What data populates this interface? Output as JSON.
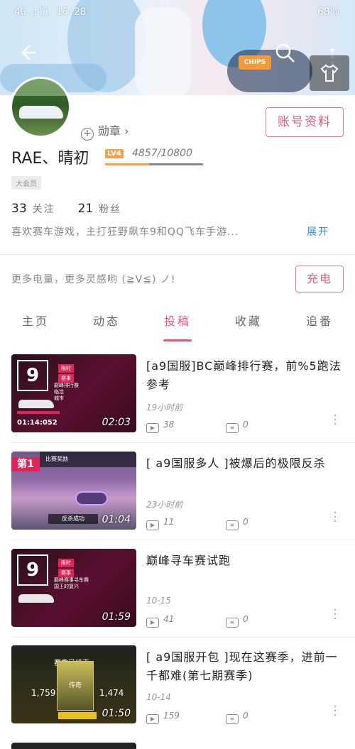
{
  "status_bar": {
    "left": "4G ıll 16:28",
    "right": "68%"
  },
  "header": {
    "banner_text": "CHIPS"
  },
  "profile": {
    "medal_label": "勋章",
    "account_button": "账号资料",
    "username": "RAE、晴初",
    "level": "LV4",
    "exp": "4857/10800",
    "exp_fraction": 0.45,
    "tag": "大会员",
    "following_count": "33",
    "following_label": "关注",
    "fans_count": "21",
    "fans_label": "粉丝",
    "bio": "喜欢赛车游戏，主打狂野飙车9和QQ飞车手游...",
    "expand": "展开"
  },
  "charge": {
    "text": "更多电量，更多灵感哟 (≧V≦) ノ!",
    "button": "充电"
  },
  "tabs": [
    {
      "label": "主页"
    },
    {
      "label": "动态"
    },
    {
      "label": "投稿"
    },
    {
      "label": "收藏"
    },
    {
      "label": "追番"
    }
  ],
  "active_tab": "投稿",
  "videos": [
    {
      "title": "[a9国服]BC巅峰排行赛，前%5跑法参考",
      "time": "19小时前",
      "plays": "38",
      "danmaku": "0",
      "duration": "02:03",
      "thumb": {
        "big": "9",
        "tag1": "限时",
        "tag2": "赛事",
        "line1": "巅峰排行赛",
        "line2": "临沧",
        "line3": "城市",
        "timer": "01:14:052"
      }
    },
    {
      "title": "[ a9国服多人 ]被爆后的极限反杀",
      "time": "23小时前",
      "plays": "11",
      "danmaku": "0",
      "duration": "01:04",
      "thumb": {
        "flag": "第1",
        "bar": "比赛奖励",
        "overlay": "反杀成功"
      }
    },
    {
      "title": "巅峰寻车赛试跑",
      "time": "10-15",
      "plays": "41",
      "danmaku": "0",
      "duration": "01:59",
      "thumb": {
        "big": "9",
        "tag1": "限时",
        "tag2": "赛事",
        "line1": "巅峰赛事寻车赛",
        "line2": "国王的复兴"
      }
    },
    {
      "title": "[ a9国服开包 ]现在这赛季，进前一千都难(第七期赛季)",
      "time": "10-14",
      "plays": "159",
      "danmaku": "0",
      "duration": "01:50",
      "thumb": {
        "card": "传奇",
        "left": "1,759",
        "right": "1,474",
        "header": "赛季已结束"
      }
    }
  ]
}
